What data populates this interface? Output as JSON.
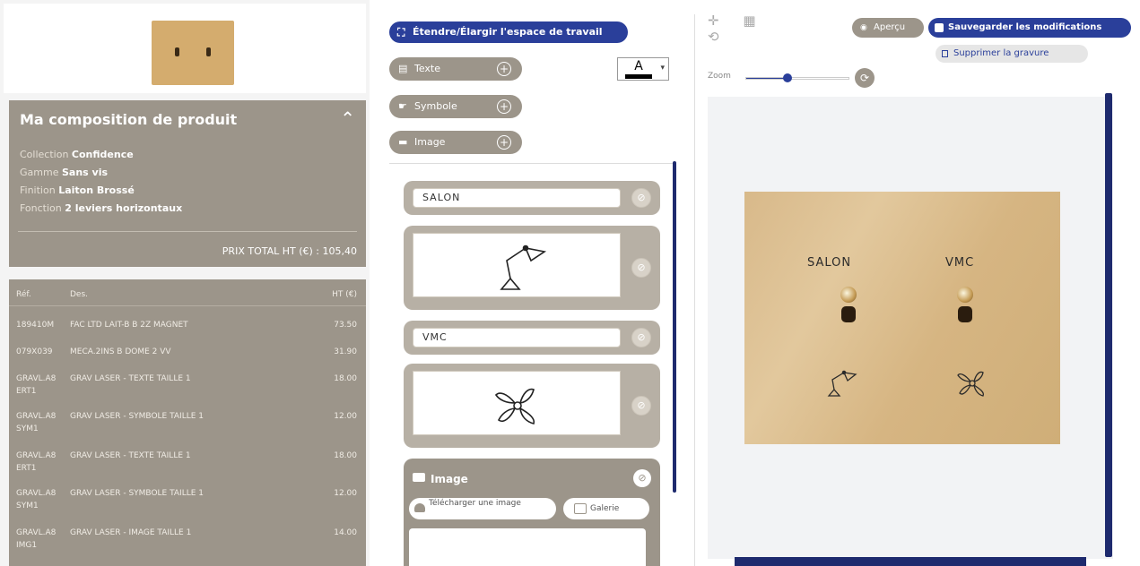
{
  "composition": {
    "title": "Ma composition de produit",
    "collection_label": "Collection",
    "collection_value": "Confidence",
    "gamme_label": "Gamme",
    "gamme_value": "Sans vis",
    "finition_label": "Finition",
    "finition_value": "Laiton Brossé",
    "fonction_label": "Fonction",
    "fonction_value": "2 leviers horizontaux",
    "total": "PRIX TOTAL HT (€) : 105,40"
  },
  "table": {
    "headers": {
      "ref": "Réf.",
      "des": "Des.",
      "ht": "HT (€)"
    },
    "rows": [
      {
        "ref": "189410M",
        "des": "FAC LTD LAIT-B B 2Z MAGNET",
        "ht": "73.50"
      },
      {
        "ref": "079X039",
        "des": "MECA.2INS B DOME 2 VV",
        "ht": "31.90"
      },
      {
        "ref": "GRAVL.A8 ERT1",
        "des": "GRAV LASER - TEXTE TAILLE 1",
        "ht": "18.00"
      },
      {
        "ref": "GRAVL.A8 SYM1",
        "des": "GRAV LASER - SYMBOLE TAILLE 1",
        "ht": "12.00"
      },
      {
        "ref": "GRAVL.A8 ERT1",
        "des": "GRAV LASER - TEXTE TAILLE 1",
        "ht": "18.00"
      },
      {
        "ref": "GRAVL.A8 SYM1",
        "des": "GRAV LASER - SYMBOLE TAILLE 1",
        "ht": "12.00"
      },
      {
        "ref": "GRAVL.A8 IMG1",
        "des": "GRAV LASER - IMAGE TAILLE 1",
        "ht": "14.00"
      }
    ]
  },
  "editor": {
    "workspace_button": "Étendre/Élargir l'espace de travail",
    "tools": {
      "text": "Texte",
      "symbol": "Symbole",
      "image": "Image"
    },
    "font_letter": "A",
    "text_color": "#000000",
    "layers": {
      "layer1_text": "SALON",
      "layer3_text": "VMC"
    },
    "image_panel": {
      "title": "Image",
      "upload": "Télécharger une image",
      "gallery": "Galerie"
    }
  },
  "preview": {
    "apercu": "Aperçu",
    "save": "Sauvegarder les modifications",
    "delete_engraving": "Supprimer la gravure",
    "zoom_label": "Zoom",
    "zoom_level": 0.4,
    "plate_label_left": "SALON",
    "plate_label_right": "VMC"
  },
  "icons": {
    "desk_lamp": "desk-lamp-icon",
    "fan": "fan-icon"
  }
}
